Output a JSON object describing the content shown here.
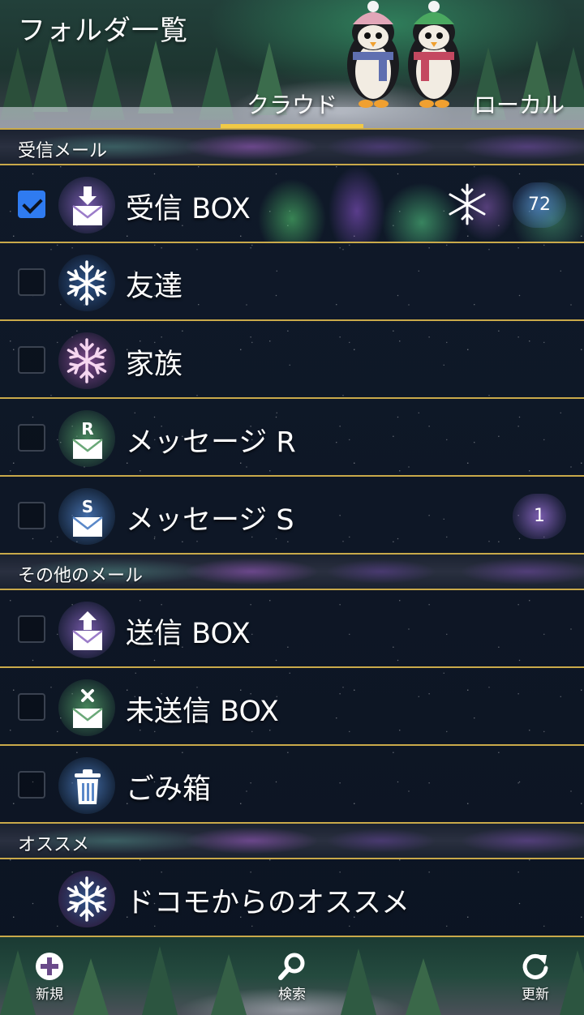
{
  "header": {
    "title": "フォルダ一覧",
    "tabs": [
      {
        "label": "クラウド",
        "selected": true
      },
      {
        "label": "ローカル",
        "selected": false
      }
    ]
  },
  "sections": [
    {
      "title": "受信メール",
      "rows": [
        {
          "label": "受信 BOX",
          "icon": "inbox-download-icon",
          "checked": true,
          "badge": "72",
          "decoration": "snowflake-icon"
        },
        {
          "label": "友達",
          "icon": "snowflake-blue-icon",
          "checked": false
        },
        {
          "label": "家族",
          "icon": "snowflake-pink-icon",
          "checked": false
        },
        {
          "label": "メッセージ R",
          "icon": "mail-r-icon",
          "icon_letter": "R",
          "checked": false
        },
        {
          "label": "メッセージ S",
          "icon": "mail-s-icon",
          "icon_letter": "S",
          "checked": false,
          "badge": "1"
        }
      ]
    },
    {
      "title": "その他のメール",
      "rows": [
        {
          "label": "送信 BOX",
          "icon": "outbox-upload-icon",
          "checked": false
        },
        {
          "label": "未送信 BOX",
          "icon": "mail-unsent-icon",
          "checked": false
        },
        {
          "label": "ごみ箱",
          "icon": "trash-icon",
          "checked": false
        }
      ]
    },
    {
      "title": "オススメ",
      "rows": [
        {
          "label": "ドコモからのオススメ",
          "icon": "snowflake-recommend-icon"
        }
      ]
    }
  ],
  "bottom_bar": {
    "new_label": "新規",
    "search_label": "検索",
    "refresh_label": "更新"
  },
  "colors": {
    "accent_gold": "#c9a94a",
    "tab_indicator": "#f1c946",
    "checkbox_checked": "#2f7bf0"
  }
}
